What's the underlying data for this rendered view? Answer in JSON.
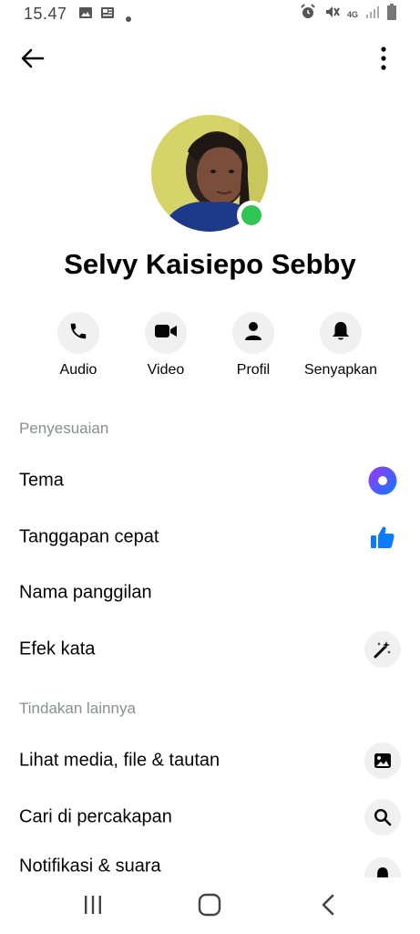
{
  "status_bar": {
    "time": "15.47",
    "network": "4G"
  },
  "app_bar": {
    "back_icon": "arrow-left-icon",
    "more_icon": "more-vertical-icon"
  },
  "profile": {
    "name": "Selvy Kaisiepo Sebby",
    "online": true,
    "presence_color": "#31c653"
  },
  "actions": [
    {
      "label": "Audio",
      "icon": "phone-icon"
    },
    {
      "label": "Video",
      "icon": "video-camera-icon"
    },
    {
      "label": "Profil",
      "icon": "person-icon"
    },
    {
      "label": "Senyapkan",
      "icon": "bell-icon"
    }
  ],
  "sections": [
    {
      "title": "Penyesuaian",
      "items": [
        {
          "label": "Tema",
          "icon": "theme-circle-icon"
        },
        {
          "label": "Tanggapan cepat",
          "icon": "thumbs-up-icon"
        },
        {
          "label": "Nama panggilan",
          "icon": ""
        },
        {
          "label": "Efek kata",
          "icon": "magic-wand-icon"
        }
      ]
    },
    {
      "title": "Tindakan lainnya",
      "items": [
        {
          "label": "Lihat media, file & tautan",
          "icon": "image-icon"
        },
        {
          "label": "Cari di percakapan",
          "icon": "search-icon"
        },
        {
          "label": "Notifikasi & suara",
          "icon": "bell-icon"
        }
      ]
    }
  ],
  "colors": {
    "accent_blue": "#0a7cff",
    "theme_gradient_start": "#a033ff",
    "theme_gradient_end": "#0a7cff",
    "section_header": "#8a8d91"
  }
}
